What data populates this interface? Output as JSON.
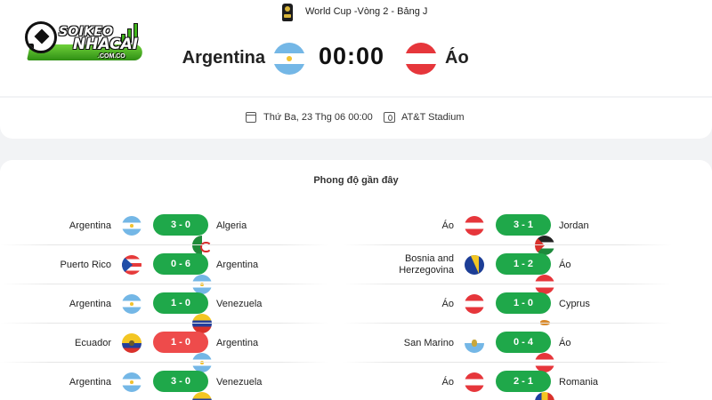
{
  "logo": {
    "line1": "SOIKEO",
    "line2": "NHACAI",
    "line3": ".COM.CO"
  },
  "competition": {
    "icon": "trophy-icon",
    "label": "World Cup -Vòng 2 - Bảng J"
  },
  "match": {
    "home_team": "Argentina",
    "away_team": "Áo",
    "score": "00:00",
    "home_flag": "argentina",
    "away_flag": "austria"
  },
  "info": {
    "date": "Thứ Ba, 23 Thg 06 00:00",
    "stadium": "AT&T Stadium"
  },
  "form": {
    "title": "Phong độ gần đây",
    "home_matches": [
      {
        "home": "Argentina",
        "home_flag": "argentina",
        "score": "3 - 0",
        "away": "Algeria",
        "away_flag": "algeria",
        "result": "win"
      },
      {
        "home": "Puerto Rico",
        "home_flag": "puertorico",
        "score": "0 - 6",
        "away": "Argentina",
        "away_flag": "argentina",
        "result": "win"
      },
      {
        "home": "Argentina",
        "home_flag": "argentina",
        "score": "1 - 0",
        "away": "Venezuela",
        "away_flag": "venezuela",
        "result": "win"
      },
      {
        "home": "Ecuador",
        "home_flag": "ecuador",
        "score": "1 - 0",
        "away": "Argentina",
        "away_flag": "argentina",
        "result": "loss"
      },
      {
        "home": "Argentina",
        "home_flag": "argentina",
        "score": "3 - 0",
        "away": "Venezuela",
        "away_flag": "venezuela",
        "result": "win"
      }
    ],
    "away_matches": [
      {
        "home": "Áo",
        "home_flag": "austria",
        "score": "3 - 1",
        "away": "Jordan",
        "away_flag": "jordan",
        "result": "win"
      },
      {
        "home": "Bosnia and Herzegovina",
        "home_flag": "bosnia",
        "score": "1 - 2",
        "away": "Áo",
        "away_flag": "austria",
        "result": "win"
      },
      {
        "home": "Áo",
        "home_flag": "austria",
        "score": "1 - 0",
        "away": "Cyprus",
        "away_flag": "cyprus",
        "result": "win"
      },
      {
        "home": "San Marino",
        "home_flag": "sanmarino",
        "score": "0 - 4",
        "away": "Áo",
        "away_flag": "austria",
        "result": "win"
      },
      {
        "home": "Áo",
        "home_flag": "austria",
        "score": "2 - 1",
        "away": "Romania",
        "away_flag": "romania",
        "result": "win"
      }
    ]
  },
  "colors": {
    "win": "#1fa84a",
    "loss": "#ee4b4b",
    "background": "#f2f3f5"
  }
}
